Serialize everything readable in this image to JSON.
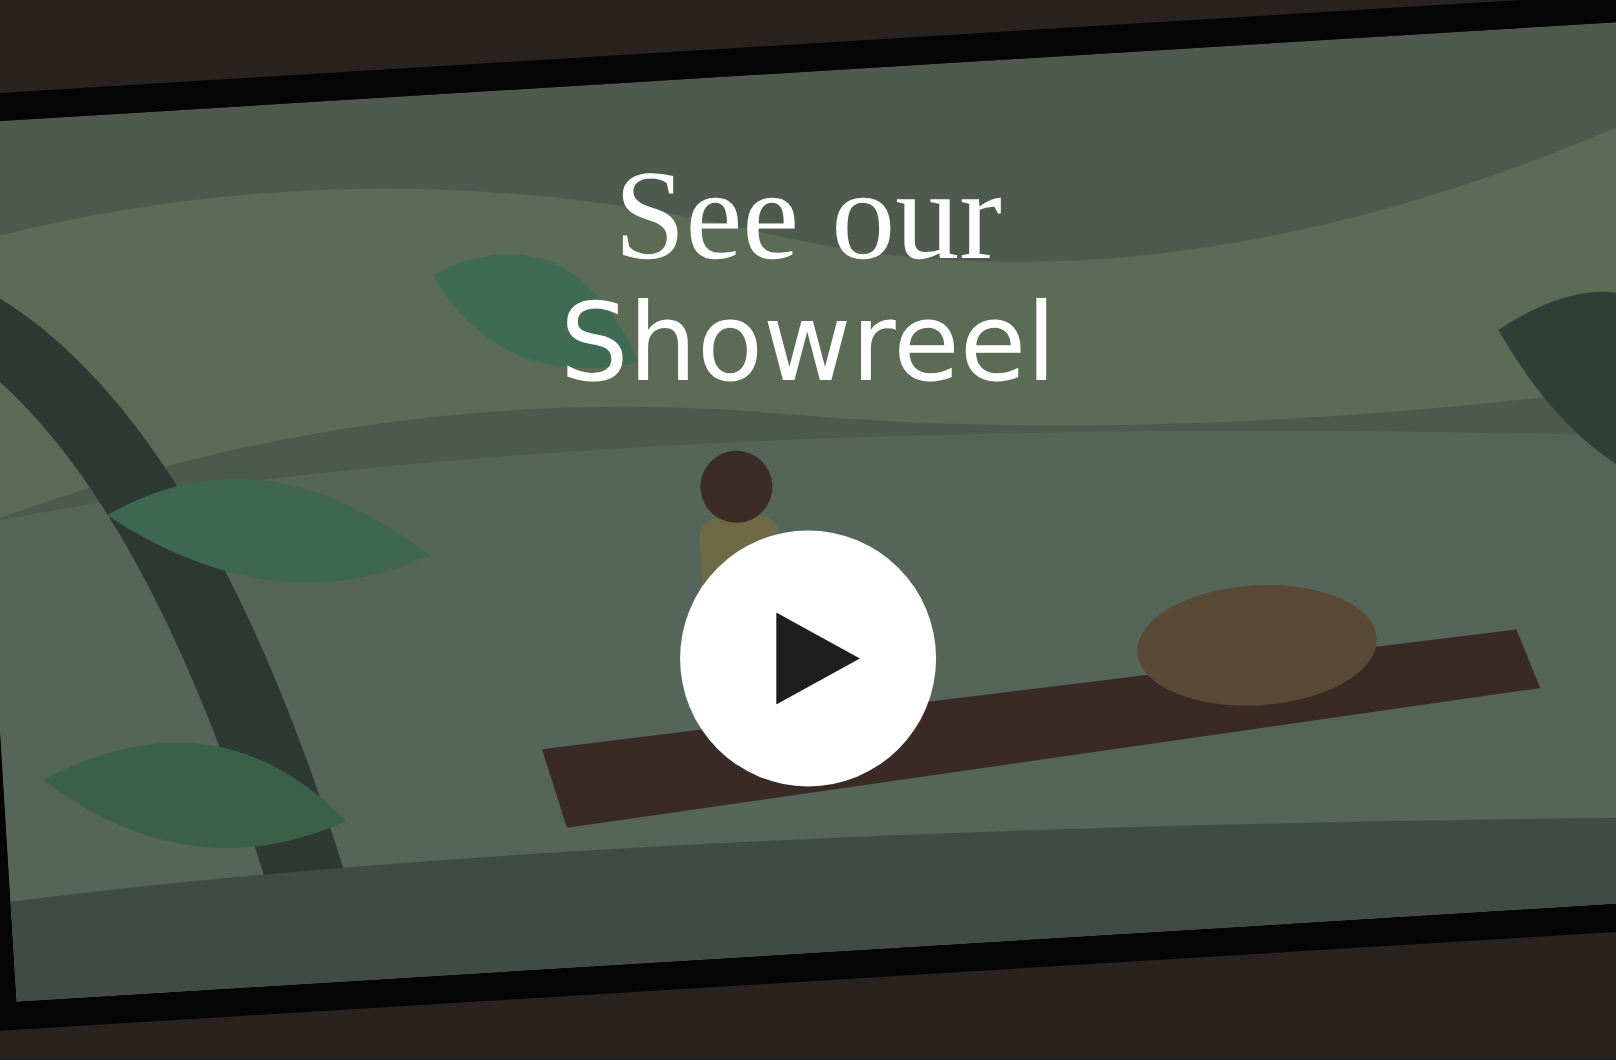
{
  "heading_lines": [
    "See our",
    "Showreel"
  ]
}
